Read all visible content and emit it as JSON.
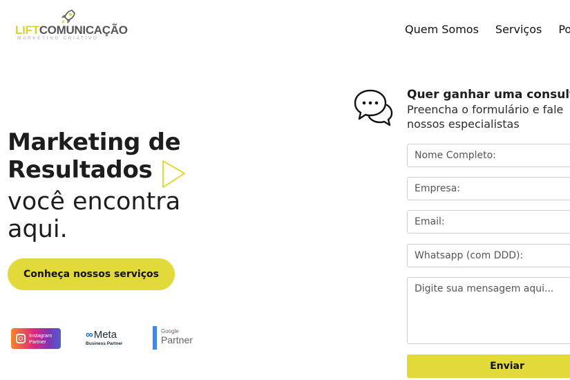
{
  "brand": {
    "name_part1": "LIFT",
    "name_part2": "COMUNICAÇÃO",
    "tagline": "MARKETING CRIATIVO",
    "accent_color": "#e2d93b"
  },
  "nav": {
    "items": [
      "Quem Somos",
      "Serviços",
      "Po"
    ]
  },
  "hero": {
    "title_line1": "Marketing de",
    "title_line2": "Resultados",
    "sub_line1": "você encontra",
    "sub_line2": "aqui.",
    "cta_label": "Conheça nossos serviços"
  },
  "partners": {
    "instagram_line1": "Instagram",
    "instagram_line2": "Partner",
    "meta_name": "Meta",
    "meta_sub": "Business Partner",
    "google_small": "Google",
    "google_big": "Partner"
  },
  "form": {
    "heading": "Quer ganhar uma consulto",
    "sub_line1": "Preencha o formulário e fale",
    "sub_line2": "nossos especialistas",
    "name_placeholder": "Nome Completo:",
    "company_placeholder": "Empresa:",
    "email_placeholder": "Email:",
    "whatsapp_placeholder": "Whatsapp (com DDD):",
    "message_placeholder": "Digite sua mensagem aqui...",
    "submit_label": "Enviar"
  }
}
